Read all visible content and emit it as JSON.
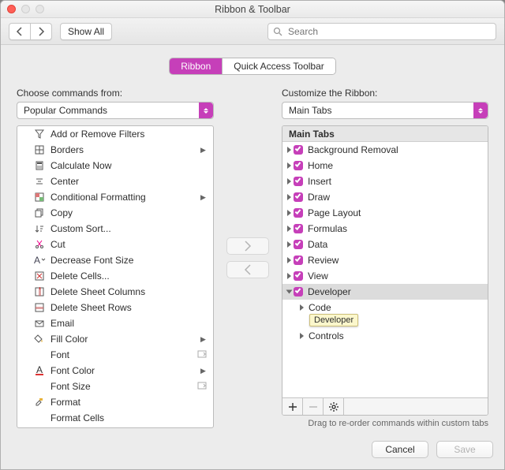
{
  "window": {
    "title": "Ribbon & Toolbar"
  },
  "toolbar": {
    "show_all_label": "Show All",
    "search_placeholder": "Search"
  },
  "tabs": {
    "ribbon": "Ribbon",
    "qat": "Quick Access Toolbar"
  },
  "left": {
    "label": "Choose commands from:",
    "select_value": "Popular Commands",
    "commands": [
      {
        "icon": "funnel",
        "label": "Add or Remove Filters",
        "submenu": false,
        "opts": false
      },
      {
        "icon": "borders",
        "label": "Borders",
        "submenu": true,
        "opts": false
      },
      {
        "icon": "calculator",
        "label": "Calculate Now",
        "submenu": false,
        "opts": false
      },
      {
        "icon": "center",
        "label": "Center",
        "submenu": false,
        "opts": false
      },
      {
        "icon": "cond-fmt",
        "label": "Conditional Formatting",
        "submenu": true,
        "opts": false
      },
      {
        "icon": "copy",
        "label": "Copy",
        "submenu": false,
        "opts": false
      },
      {
        "icon": "sort",
        "label": "Custom Sort...",
        "submenu": false,
        "opts": false
      },
      {
        "icon": "cut",
        "label": "Cut",
        "submenu": false,
        "opts": false
      },
      {
        "icon": "font-dec",
        "label": "Decrease Font Size",
        "submenu": false,
        "opts": false
      },
      {
        "icon": "del-cells",
        "label": "Delete Cells...",
        "submenu": false,
        "opts": false
      },
      {
        "icon": "del-cols",
        "label": "Delete Sheet Columns",
        "submenu": false,
        "opts": false
      },
      {
        "icon": "del-rows",
        "label": "Delete Sheet Rows",
        "submenu": false,
        "opts": false
      },
      {
        "icon": "email",
        "label": "Email",
        "submenu": false,
        "opts": false
      },
      {
        "icon": "fill",
        "label": "Fill Color",
        "submenu": true,
        "opts": false
      },
      {
        "icon": "none",
        "label": "Font",
        "submenu": false,
        "opts": true
      },
      {
        "icon": "font-color",
        "label": "Font Color",
        "submenu": true,
        "opts": false
      },
      {
        "icon": "none",
        "label": "Font Size",
        "submenu": false,
        "opts": true
      },
      {
        "icon": "format",
        "label": "Format",
        "submenu": false,
        "opts": false
      },
      {
        "icon": "none",
        "label": "Format Cells",
        "submenu": false,
        "opts": false
      }
    ]
  },
  "right": {
    "label": "Customize the Ribbon:",
    "select_value": "Main Tabs",
    "header": "Main Tabs",
    "tabs": [
      {
        "label": "Background Removal",
        "checked": true,
        "selected": false,
        "expanded": false
      },
      {
        "label": "Home",
        "checked": true,
        "selected": false,
        "expanded": false
      },
      {
        "label": "Insert",
        "checked": true,
        "selected": false,
        "expanded": false
      },
      {
        "label": "Draw",
        "checked": true,
        "selected": false,
        "expanded": false
      },
      {
        "label": "Page Layout",
        "checked": true,
        "selected": false,
        "expanded": false
      },
      {
        "label": "Formulas",
        "checked": true,
        "selected": false,
        "expanded": false
      },
      {
        "label": "Data",
        "checked": true,
        "selected": false,
        "expanded": false
      },
      {
        "label": "Review",
        "checked": true,
        "selected": false,
        "expanded": false
      },
      {
        "label": "View",
        "checked": true,
        "selected": false,
        "expanded": false
      },
      {
        "label": "Developer",
        "checked": true,
        "selected": true,
        "expanded": true,
        "children": [
          {
            "label": "Code",
            "tooltip": "Developer"
          },
          {
            "label": "Controls"
          }
        ]
      }
    ],
    "hint": "Drag to re-order commands within custom tabs"
  },
  "actions": {
    "cancel": "Cancel",
    "save": "Save"
  }
}
